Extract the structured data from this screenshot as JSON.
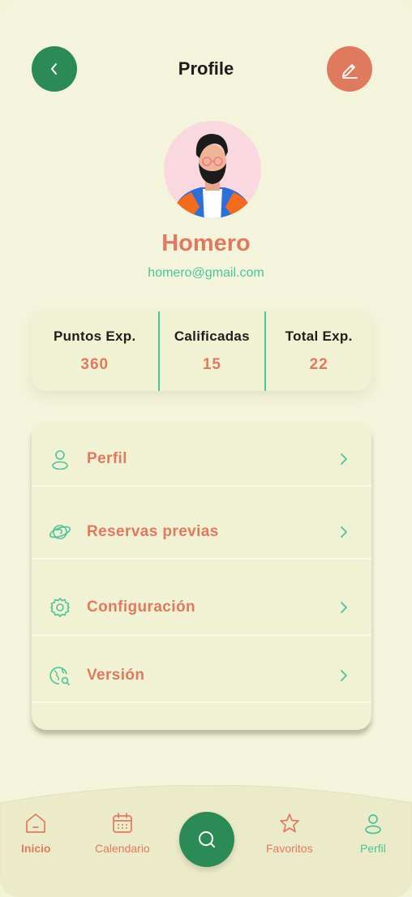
{
  "header": {
    "title": "Profile",
    "back_icon": "chevron-left-icon",
    "edit_icon": "pencil-icon"
  },
  "user": {
    "name": "Homero",
    "email": "homero@gmail.com",
    "avatar_icon": "avatar-illustration"
  },
  "stats": [
    {
      "label": "Puntos Exp.",
      "value": "360"
    },
    {
      "label": "Calificadas",
      "value": "15"
    },
    {
      "label": "Total Exp.",
      "value": "22"
    }
  ],
  "menu": [
    {
      "label": "Perfil",
      "icon": "user-icon"
    },
    {
      "label": "Reservas previas",
      "icon": "planet-icon"
    },
    {
      "label": "Configuración",
      "icon": "gear-icon"
    },
    {
      "label": "Versión",
      "icon": "globe-search-icon"
    }
  ],
  "bottom_nav": {
    "items": [
      {
        "label": "Inicio",
        "icon": "home-icon",
        "active": true
      },
      {
        "label": "Calendario",
        "icon": "calendar-icon"
      },
      {
        "label": "Favoritos",
        "icon": "star-icon"
      },
      {
        "label": "Perfil",
        "icon": "user-icon"
      }
    ],
    "center_icon": "search-icon"
  },
  "colors": {
    "background": "#f4f4dc",
    "primary_green": "#2b8a55",
    "accent_orange": "#e07a5f",
    "mint": "#4cc39a"
  }
}
